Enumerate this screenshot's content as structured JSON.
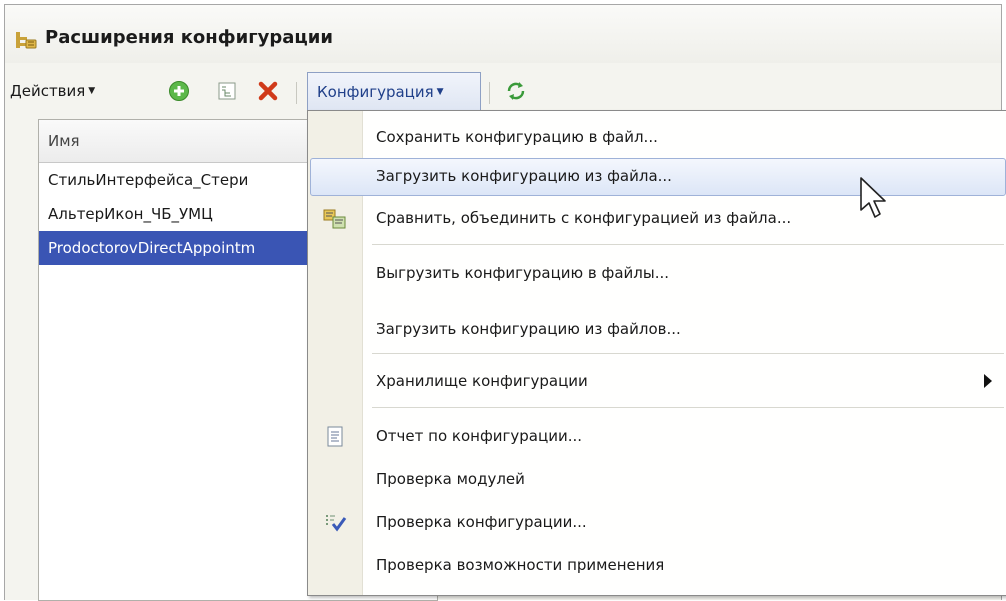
{
  "window": {
    "title": "Расширения конфигурации"
  },
  "toolbar": {
    "actions_label": "Действия",
    "configuration_label": "Конфигурация",
    "icons": [
      "add-icon",
      "properties-icon",
      "delete-icon",
      "refresh-icon"
    ]
  },
  "list": {
    "column_name": "Имя",
    "rows": [
      {
        "name": "СтильИнтерфейса_Стери",
        "selected": false
      },
      {
        "name": "АльтерИкон_ЧБ_УМЦ",
        "selected": false
      },
      {
        "name": "ProdoctorovDirectAppointm",
        "selected": true
      }
    ]
  },
  "menu": {
    "items": [
      {
        "label": "Сохранить конфигурацию в файл..."
      },
      {
        "label": "Загрузить конфигурацию из файла...",
        "highlighted": true
      },
      {
        "label": "Сравнить, объединить с конфигурацией из файла...",
        "icon": "compare-icon"
      },
      {
        "label": "Выгрузить конфигурацию в файлы..."
      },
      {
        "label": "Загрузить конфигурацию из файлов..."
      },
      {
        "label": "Хранилище конфигурации",
        "submenu": true
      },
      {
        "label": "Отчет по конфигурации...",
        "icon": "report-icon"
      },
      {
        "label": "Проверка модулей"
      },
      {
        "label": "Проверка конфигурации...",
        "icon": "check-icon"
      },
      {
        "label": "Проверка возможности применения"
      }
    ]
  },
  "colors": {
    "selection": "#3a55b4",
    "menu_highlight_border": "#9fb2d8",
    "configuration_button_text": "#20408a"
  }
}
